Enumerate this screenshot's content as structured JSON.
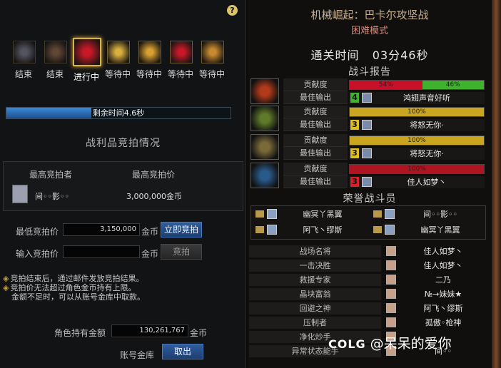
{
  "left": {
    "help": "?",
    "stages": [
      {
        "label": "结束",
        "state": "done"
      },
      {
        "label": "结束",
        "state": "done"
      },
      {
        "label": "进行中",
        "state": "current"
      },
      {
        "label": "等待中",
        "state": "wait"
      },
      {
        "label": "等待中",
        "state": "wait"
      },
      {
        "label": "等待中",
        "state": "wait"
      },
      {
        "label": "等待中",
        "state": "wait"
      }
    ],
    "progress": {
      "text": "剩余时间4.6秒",
      "fraction": 0.38
    },
    "section_title": "战利品竞拍情况",
    "bid": {
      "col1": "最高竞拍者",
      "col2": "最高竞拍价",
      "bidder": "间◦◦影◦◦",
      "price": "3,000,000金币"
    },
    "min_bid": {
      "label": "最低竞拍价",
      "value": "3,150,000",
      "unit": "金币",
      "button": "立即竞拍"
    },
    "input_bid": {
      "label": "输入竞拍价",
      "value": "",
      "unit": "金币",
      "button": "竞拍"
    },
    "notes": [
      "竞拍结束后，通过邮件发放竞拍结果。",
      "竞拍价无法超过角色金币持有上限。",
      "金额不足时，可以从账号金库中取款。"
    ],
    "gold": {
      "label": "角色持有金额",
      "value": "130,261,767",
      "unit": "金币"
    },
    "vault": {
      "label": "账号金库",
      "button": "取出"
    }
  },
  "right": {
    "title": "机械崛起：巴卡尔攻坚战",
    "mode": "困难模式",
    "clear_label": "通关时间",
    "clear_time": "03分46秒",
    "report_title": "战斗报告",
    "contrib_label": "贡献度",
    "best_label": "最佳输出",
    "rows": [
      {
        "segs": [
          {
            "pct": 54,
            "color": "#c8102a",
            "label": "54%"
          },
          {
            "pct": 46,
            "color": "#3fb22e",
            "label": "46%"
          }
        ],
        "num": "4",
        "numcolor": "#3fb22e",
        "name": "鸿翅声音好听",
        "icon": "#b23a1a"
      },
      {
        "segs": [
          {
            "pct": 100,
            "color": "#c9a520",
            "label": "100%"
          }
        ],
        "num": "3",
        "numcolor": "#e0c020",
        "name": "将怒无你·",
        "icon": "#5f7a2a"
      },
      {
        "segs": [
          {
            "pct": 100,
            "color": "#c9a520",
            "label": "100%"
          }
        ],
        "num": "3",
        "numcolor": "#e0c020",
        "name": "将怒无你·",
        "icon": "#7a6a3a"
      },
      {
        "segs": [
          {
            "pct": 100,
            "color": "#b01420",
            "label": "100%"
          }
        ],
        "num": "3",
        "numcolor": "#d8202a",
        "name": "佳人如梦丶",
        "icon": "#2a5a8a"
      }
    ],
    "honor_title": "荣誉战斗员",
    "honor": [
      "幽冥丫黑翼",
      "间◦◦影◦◦",
      "阿飞丶缪斯",
      "幽冥丫黑翼"
    ],
    "awards": [
      {
        "name": "战场名将",
        "player": "佳人如梦丶"
      },
      {
        "name": "一击决胜",
        "player": "佳人如梦丶"
      },
      {
        "name": "救援专家",
        "player": "二乃"
      },
      {
        "name": "晶块富翁",
        "player": "№→妹妹★"
      },
      {
        "name": "回避之神",
        "player": "阿飞丶缪斯"
      },
      {
        "name": "压制者",
        "player": "孤傲◦枪神"
      },
      {
        "name": "净化炒手",
        "player": ""
      },
      {
        "name": "异常状态能手",
        "player": "间◦◦"
      }
    ]
  },
  "watermark": {
    "logo": "COLG",
    "text": "@呆呆的爱你"
  }
}
